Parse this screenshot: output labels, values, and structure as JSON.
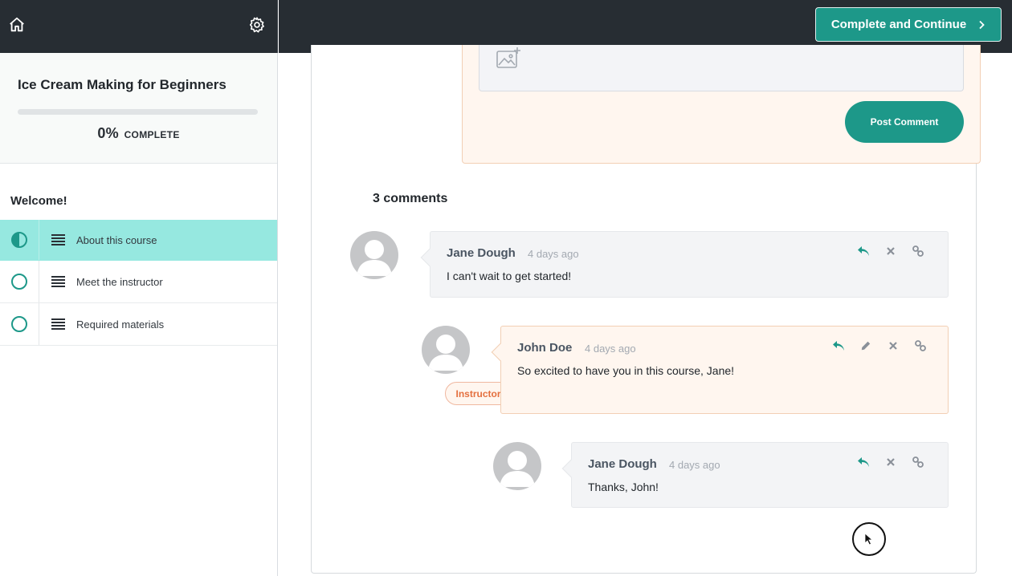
{
  "header": {
    "home_icon": "home-icon",
    "settings_icon": "gear-icon",
    "cta_label": "Complete and Continue"
  },
  "course": {
    "title": "Ice Cream Making for Beginners",
    "progress_percent": 0,
    "progress_value": "0%",
    "progress_label": "COMPLETE"
  },
  "sidebar": {
    "section_title": "Welcome!",
    "lessons": [
      {
        "label": "About this course",
        "status": "in-progress",
        "active": true
      },
      {
        "label": "Meet the instructor",
        "status": "not-started",
        "active": false
      },
      {
        "label": "Required materials",
        "status": "not-started",
        "active": false
      }
    ]
  },
  "compose": {
    "post_label": "Post Comment"
  },
  "comments": {
    "count_label": "3 comments",
    "items": [
      {
        "author": "Jane Dough",
        "time": "4 days ago",
        "body": "I can't wait to get started!"
      },
      {
        "author": "John Doe",
        "time": "4 days ago",
        "body": "So excited to have you in this course, Jane!",
        "badge": "Instructor"
      },
      {
        "author": "Jane Dough",
        "time": "4 days ago",
        "body": "Thanks, John!"
      }
    ]
  },
  "colors": {
    "accent": "#1d9889",
    "topbar": "#272d33",
    "active_lesson": "#96e8e0",
    "instructor_bubble": "#fff6ef",
    "instructor_badge_text": "#e4703f"
  }
}
